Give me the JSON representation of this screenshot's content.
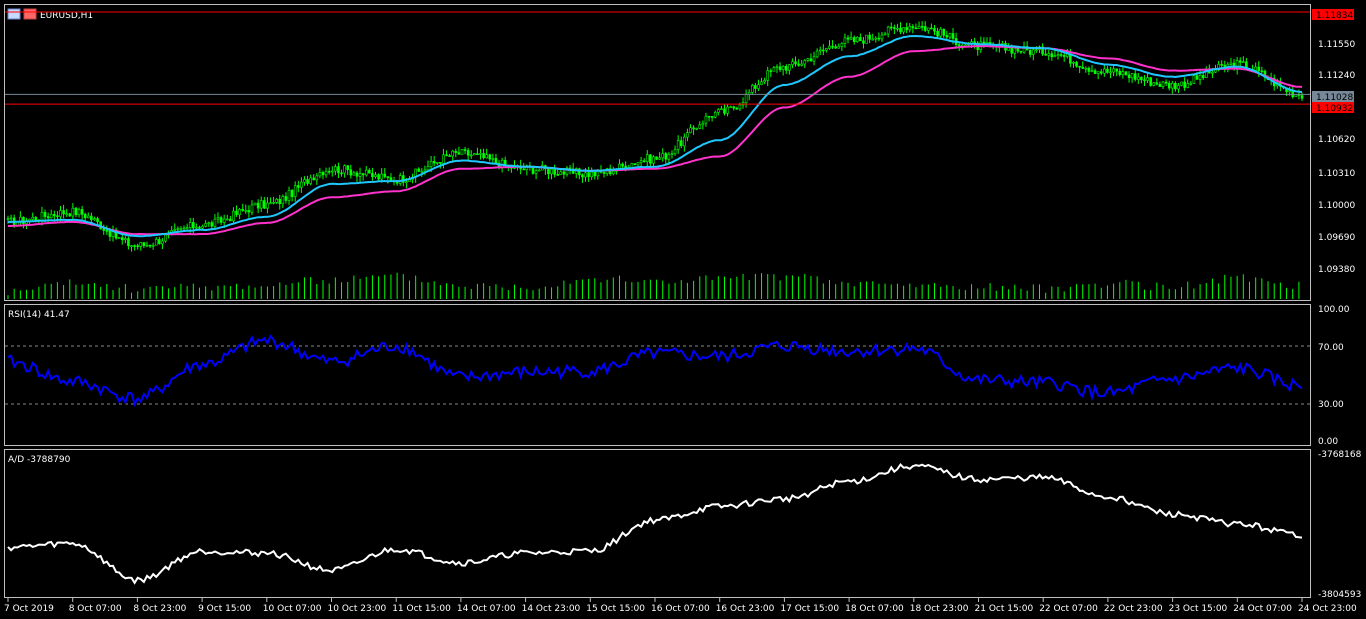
{
  "window": {
    "symbol_label": "EURUSD,H1"
  },
  "price_pane": {
    "price_axis_labels": [
      "1.11834",
      "1.11550",
      "1.11240",
      "1.10620",
      "1.10310",
      "1.10000",
      "1.09690",
      "1.09380"
    ],
    "hline_upper": {
      "value": "1.11834",
      "color": "#ff0000"
    },
    "hline_lower": {
      "value": "1.10932",
      "color": "#ff0000"
    },
    "bid_line": {
      "value": "1.11028",
      "color": "#778899"
    },
    "candle_color": "#00ff00",
    "volume_color": "#00ff00",
    "ma_fast_color": "#1ec8ff",
    "ma_slow_color": "#ff33cc"
  },
  "rsi_pane": {
    "title": "RSI(14) 41.47",
    "levels": [
      "100.00",
      "70.00",
      "30.00",
      "0.00"
    ],
    "line_color": "#0000ff"
  },
  "ad_pane": {
    "title": "A/D -3788790",
    "axis_top": "-3768168",
    "axis_bottom": "-3804593",
    "line_color": "#ffffff"
  },
  "time_axis": [
    "7 Oct 2019",
    "8 Oct 07:00",
    "8 Oct 23:00",
    "9 Oct 15:00",
    "10 Oct 07:00",
    "10 Oct 23:00",
    "11 Oct 15:00",
    "14 Oct 07:00",
    "14 Oct 23:00",
    "15 Oct 15:00",
    "16 Oct 07:00",
    "16 Oct 23:00",
    "17 Oct 15:00",
    "18 Oct 07:00",
    "18 Oct 23:00",
    "21 Oct 15:00",
    "22 Oct 07:00",
    "22 Oct 23:00",
    "23 Oct 15:00",
    "24 Oct 07:00",
    "24 Oct 23:00"
  ],
  "chart_data": [
    {
      "type": "line",
      "name": "EURUSD,H1 price",
      "x_categories": [
        "7 Oct 2019",
        "8 Oct 07:00",
        "8 Oct 23:00",
        "9 Oct 15:00",
        "10 Oct 07:00",
        "10 Oct 23:00",
        "11 Oct 15:00",
        "14 Oct 07:00",
        "14 Oct 23:00",
        "15 Oct 15:00",
        "16 Oct 07:00",
        "16 Oct 23:00",
        "17 Oct 15:00",
        "18 Oct 07:00",
        "18 Oct 23:00",
        "21 Oct 15:00",
        "22 Oct 07:00",
        "22 Oct 23:00",
        "23 Oct 15:00",
        "24 Oct 07:00",
        "24 Oct 23:00"
      ],
      "close": [
        1.0978,
        1.0988,
        1.0955,
        1.0975,
        1.0995,
        1.103,
        1.102,
        1.1045,
        1.103,
        1.1025,
        1.104,
        1.1085,
        1.113,
        1.1155,
        1.117,
        1.115,
        1.1145,
        1.1125,
        1.1112,
        1.1132,
        1.1103
      ],
      "ma_fast": [
        1.0978,
        1.098,
        1.0964,
        1.097,
        1.0983,
        1.1015,
        1.1018,
        1.1038,
        1.1032,
        1.1028,
        1.1032,
        1.1058,
        1.1112,
        1.114,
        1.116,
        1.1152,
        1.1148,
        1.1132,
        1.112,
        1.113,
        1.1105
      ],
      "ma_slow": [
        1.0974,
        1.0978,
        1.0966,
        1.0966,
        1.0977,
        1.1002,
        1.1008,
        1.103,
        1.1032,
        1.1028,
        1.103,
        1.1042,
        1.109,
        1.112,
        1.1145,
        1.115,
        1.1148,
        1.1138,
        1.1126,
        1.1128,
        1.111
      ],
      "volume": [
        4,
        9,
        6,
        7,
        8,
        11,
        13,
        8,
        7,
        12,
        10,
        12,
        13,
        9,
        8,
        7,
        6,
        9,
        7,
        12,
        8
      ],
      "ylim": [
        1.0925,
        1.11834
      ],
      "hlines": [
        1.11834,
        1.10932,
        1.11028
      ]
    },
    {
      "type": "line",
      "name": "RSI(14) 41.47",
      "x_categories": [
        "7 Oct 2019",
        "8 Oct 07:00",
        "8 Oct 23:00",
        "9 Oct 15:00",
        "10 Oct 07:00",
        "10 Oct 23:00",
        "11 Oct 15:00",
        "14 Oct 07:00",
        "14 Oct 23:00",
        "15 Oct 15:00",
        "16 Oct 07:00",
        "16 Oct 23:00",
        "17 Oct 15:00",
        "18 Oct 07:00",
        "18 Oct 23:00",
        "21 Oct 15:00",
        "22 Oct 07:00",
        "22 Oct 23:00",
        "23 Oct 15:00",
        "24 Oct 07:00",
        "24 Oct 23:00"
      ],
      "values": [
        60,
        45,
        32,
        58,
        76,
        60,
        72,
        48,
        52,
        53,
        66,
        64,
        72,
        68,
        70,
        46,
        44,
        36,
        47,
        55,
        41.47
      ],
      "ylim": [
        0,
        100
      ],
      "levels": [
        70,
        30
      ]
    },
    {
      "type": "line",
      "name": "A/D -3788790",
      "x_categories": [
        "7 Oct 2019",
        "8 Oct 07:00",
        "8 Oct 23:00",
        "9 Oct 15:00",
        "10 Oct 07:00",
        "10 Oct 23:00",
        "11 Oct 15:00",
        "14 Oct 07:00",
        "14 Oct 23:00",
        "15 Oct 15:00",
        "16 Oct 07:00",
        "16 Oct 23:00",
        "17 Oct 15:00",
        "18 Oct 07:00",
        "18 Oct 23:00",
        "21 Oct 15:00",
        "22 Oct 07:00",
        "22 Oct 23:00",
        "23 Oct 15:00",
        "24 Oct 07:00",
        "24 Oct 23:00"
      ],
      "values": [
        -3792000,
        -3791000,
        -3800500,
        -3793000,
        -3793500,
        -3798000,
        -3792500,
        -3796000,
        -3793500,
        -3793000,
        -3785000,
        -3781500,
        -3779500,
        -3775000,
        -3771000,
        -3774500,
        -3774000,
        -3779000,
        -3783500,
        -3786000,
        -3788790
      ],
      "ylim": [
        -3804593,
        -3768168
      ]
    }
  ]
}
